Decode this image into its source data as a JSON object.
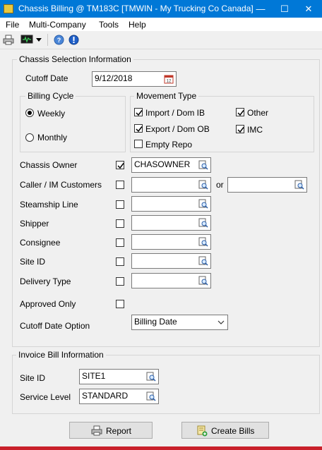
{
  "window": {
    "title": "Chassis Billing @ TM183C [TMWIN - My Trucking Co Canada]",
    "controls": {
      "minimize": "—",
      "maximize": "☐",
      "close": "✕"
    }
  },
  "menu": {
    "items": [
      "File",
      "Multi-Company",
      "Tools",
      "Help"
    ]
  },
  "toolbar": {
    "icons": [
      "printer-icon",
      "monitor-icon",
      "dropdown-arrow-icon",
      "help-icon",
      "info-icon"
    ]
  },
  "chassis_selection": {
    "group_label": "Chassis Selection Information",
    "cutoff_date_label": "Cutoff Date",
    "cutoff_date_value": "9/12/2018",
    "billing_cycle": {
      "label": "Billing Cycle",
      "options": [
        {
          "label": "Weekly",
          "selected": true
        },
        {
          "label": "Monthly",
          "selected": false
        }
      ]
    },
    "movement_type": {
      "label": "Movement Type",
      "options": [
        {
          "label": "Import / Dom IB",
          "checked": true
        },
        {
          "label": "Export / Dom OB",
          "checked": true
        },
        {
          "label": "Empty Repo",
          "checked": false
        },
        {
          "label": "Other",
          "checked": true
        },
        {
          "label": "IMC",
          "checked": true
        }
      ]
    },
    "fields": [
      {
        "label": "Chassis Owner",
        "checked": true,
        "value": ""
      },
      {
        "label": "Caller / IM Customers",
        "checked": false,
        "value": "",
        "or_label": "or",
        "or_value": ""
      },
      {
        "label": "Steamship Line",
        "checked": false,
        "value": ""
      },
      {
        "label": "Shipper",
        "checked": false,
        "value": ""
      },
      {
        "label": "Consignee",
        "checked": false,
        "value": ""
      },
      {
        "label": "Site ID",
        "checked": false,
        "value": ""
      },
      {
        "label": "Delivery Type",
        "checked": false,
        "value": ""
      }
    ],
    "chassis_owner_value": "CHASOWNER",
    "approved_only": {
      "label": "Approved Only",
      "checked": false
    },
    "cutoff_date_option": {
      "label": "Cutoff Date Option",
      "value": "Billing Date"
    }
  },
  "invoice_bill": {
    "group_label": "Invoice Bill Information",
    "site_id_label": "Site ID",
    "site_id_value": "SITE1",
    "service_level_label": "Service Level",
    "service_level_value": "STANDARD"
  },
  "buttons": {
    "report": "Report",
    "create_bills": "Create Bills"
  },
  "colors": {
    "titlebar": "#0078d7",
    "accent_red": "#c9202a",
    "background": "#f0f0f0"
  }
}
